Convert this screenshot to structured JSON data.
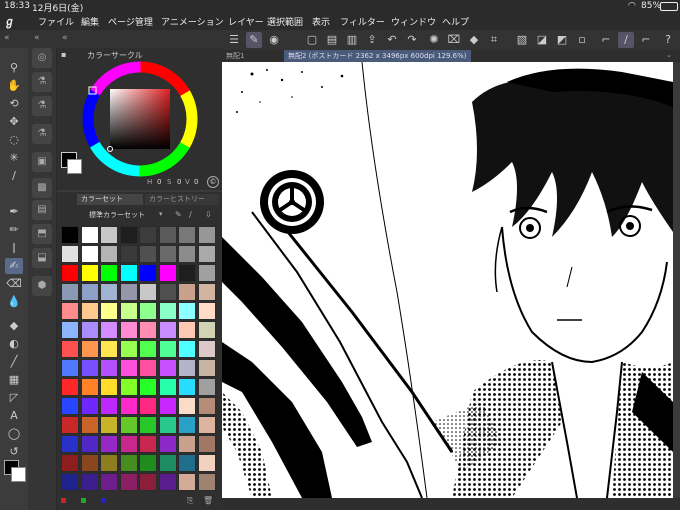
{
  "status": {
    "time": "18:33",
    "date": "12月6日(金)",
    "battery": "85%"
  },
  "menu": [
    "ファイル",
    "編集",
    "ページ管理",
    "アニメーション",
    "レイヤー",
    "選択範囲",
    "表示",
    "フィルター",
    "ウィンドウ",
    "ヘルプ"
  ],
  "color_panel": {
    "title": "カラーサークル",
    "hsv_labels": [
      "H",
      "0",
      "S",
      "0",
      "V",
      "0"
    ]
  },
  "color_set": {
    "tab1": "カラーセット",
    "tab2": "カラーヒストリー",
    "dropdown": "標準カラーセット"
  },
  "canvas_tabs": {
    "tab1": "無配1",
    "tab2": "無配2 (ポストカード 2362 x 3496px 600dpi 129.6%)"
  },
  "swatches": [
    [
      "#000000",
      "#ffffff",
      "#c8c8c8",
      "#1e1e1e",
      "#3c3c3c",
      "#5a5a5a",
      "#787878",
      "#969696"
    ],
    [
      "#e0e0e0",
      "#ffffff",
      "#b4b4b4",
      "#3a3a3a",
      "#505050",
      "#6a6a6a",
      "#8c8c8c",
      "#aaaaaa"
    ],
    [
      "#ff0000",
      "#ffff00",
      "#00ff00",
      "#00ffff",
      "#0000ff",
      "#ff00ff",
      "#1e1e1e",
      "#a0a0a0"
    ],
    [
      "#8a9ab4",
      "#8ca0c8",
      "#a0b4d2",
      "#9696aa",
      "#c8c8c8",
      "#505050",
      "#c8a08c",
      "#d2b4a0"
    ],
    [
      "#ff8c8c",
      "#ffc88c",
      "#ffff8c",
      "#c8ff8c",
      "#8cff8c",
      "#8cffc8",
      "#8cffff",
      "#ffdcc8"
    ],
    [
      "#8cb4ff",
      "#aa8cff",
      "#d28cff",
      "#ff8cd2",
      "#ff8cb4",
      "#c88cff",
      "#ffc8b4",
      "#d2d2b4"
    ],
    [
      "#ff5050",
      "#ff9650",
      "#ffe650",
      "#96ff50",
      "#50ff50",
      "#50ff96",
      "#50ffff",
      "#dcc8c8"
    ],
    [
      "#5078ff",
      "#7850ff",
      "#b450ff",
      "#ff50dc",
      "#ff50a0",
      "#c850ff",
      "#b4b4c8",
      "#c8b4a0"
    ],
    [
      "#ff2828",
      "#ff8228",
      "#ffdc28",
      "#82ff28",
      "#28ff28",
      "#28ffaa",
      "#28dcff",
      "#a0a0a0"
    ],
    [
      "#2846ff",
      "#6e28ff",
      "#be28ff",
      "#ff28c8",
      "#ff2882",
      "#c828ff",
      "#fadcc8",
      "#b48c78"
    ],
    [
      "#c82828",
      "#c86428",
      "#c8b428",
      "#64c828",
      "#28c828",
      "#28c88c",
      "#28a0c8",
      "#dcb4a0"
    ],
    [
      "#2832c8",
      "#5028c8",
      "#9628c8",
      "#c8288c",
      "#c82850",
      "#8c28c8",
      "#c8a08c",
      "#a07864"
    ],
    [
      "#8c1e1e",
      "#8c461e",
      "#8c7d1e",
      "#468c1e",
      "#1e8c1e",
      "#1e8c64",
      "#1e6e8c",
      "#f0d2be"
    ],
    [
      "#1e238c",
      "#3c1e8c",
      "#6e1e8c",
      "#8c1e64",
      "#8c1e3c",
      "#5a1e8c",
      "#d2aa96",
      "#a08270"
    ]
  ]
}
